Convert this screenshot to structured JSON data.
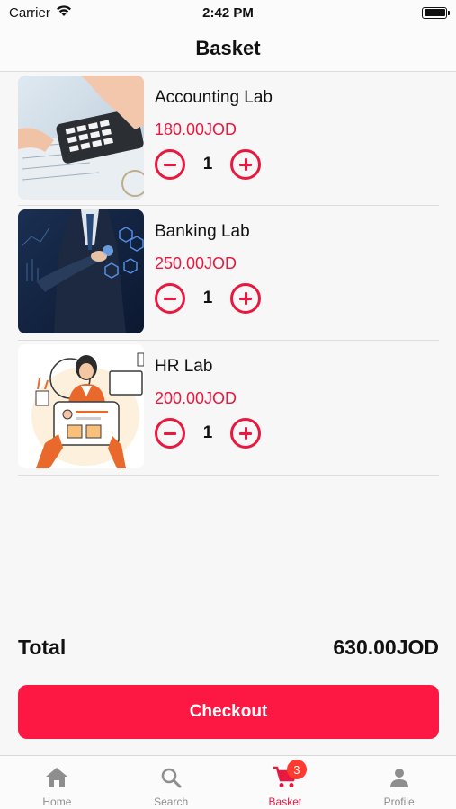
{
  "status_bar": {
    "carrier": "Carrier",
    "time": "2:42 PM"
  },
  "header": {
    "title": "Basket"
  },
  "items": [
    {
      "name": "Accounting Lab",
      "price": "180.00JOD",
      "quantity": "1",
      "image": "calculator-photo"
    },
    {
      "name": "Banking Lab",
      "price": "250.00JOD",
      "quantity": "1",
      "image": "businessman-digital-photo"
    },
    {
      "name": "HR Lab",
      "price": "200.00JOD",
      "quantity": "1",
      "image": "hr-illustration"
    }
  ],
  "total": {
    "label": "Total",
    "value": "630.00JOD"
  },
  "checkout_label": "Checkout",
  "tabs": [
    {
      "label": "Home",
      "icon": "home-icon"
    },
    {
      "label": "Search",
      "icon": "search-icon"
    },
    {
      "label": "Basket",
      "icon": "cart-icon",
      "badge": "3",
      "active": true
    },
    {
      "label": "Profile",
      "icon": "person-icon"
    }
  ],
  "colors": {
    "accent": "#e8183e",
    "button": "#fd1843",
    "badge": "#ff3b30",
    "inactive": "#8e8e8e"
  }
}
